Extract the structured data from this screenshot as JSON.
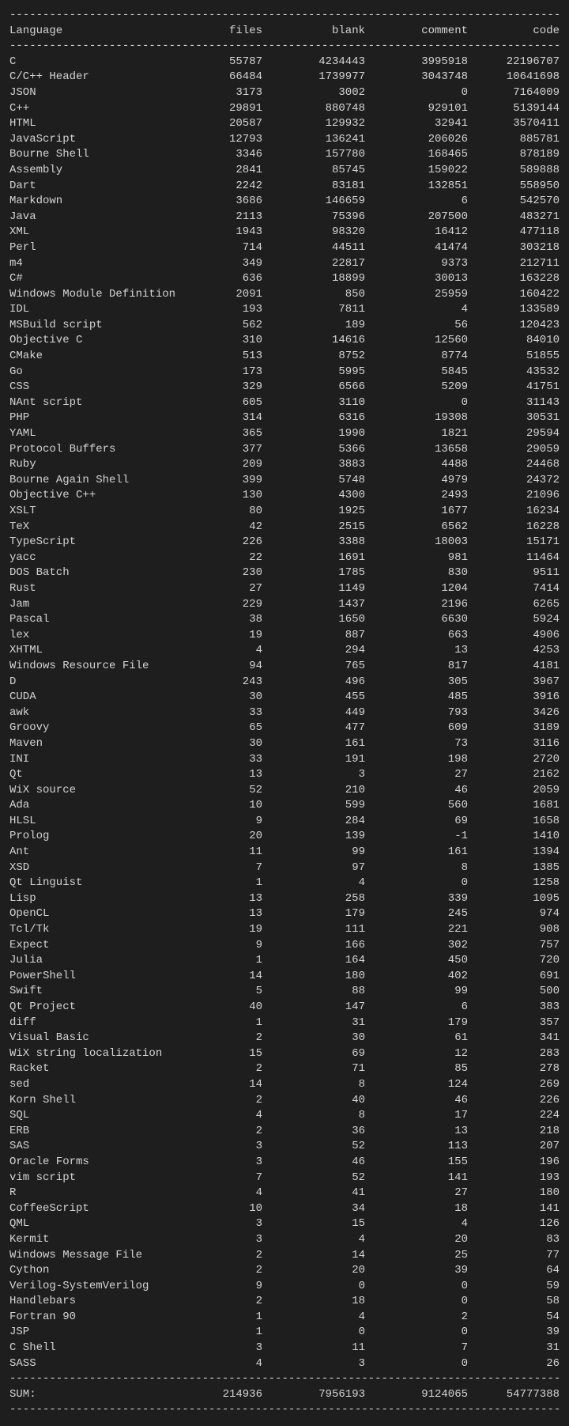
{
  "header": {
    "language": "Language",
    "files": "files",
    "blank": "blank",
    "comment": "comment",
    "code": "code"
  },
  "divider": "-------------------------------------------------------------------------------------",
  "rows": [
    {
      "language": "C",
      "files": "55787",
      "blank": "4234443",
      "comment": "3995918",
      "code": "22196707"
    },
    {
      "language": "C/C++ Header",
      "files": "66484",
      "blank": "1739977",
      "comment": "3043748",
      "code": "10641698"
    },
    {
      "language": "JSON",
      "files": "3173",
      "blank": "3002",
      "comment": "0",
      "code": "7164009"
    },
    {
      "language": "C++",
      "files": "29891",
      "blank": "880748",
      "comment": "929101",
      "code": "5139144"
    },
    {
      "language": "HTML",
      "files": "20587",
      "blank": "129932",
      "comment": "32941",
      "code": "3570411"
    },
    {
      "language": "JavaScript",
      "files": "12793",
      "blank": "136241",
      "comment": "206026",
      "code": "885781"
    },
    {
      "language": "Bourne Shell",
      "files": "3346",
      "blank": "157780",
      "comment": "168465",
      "code": "878189"
    },
    {
      "language": "Assembly",
      "files": "2841",
      "blank": "85745",
      "comment": "159022",
      "code": "589888"
    },
    {
      "language": "Dart",
      "files": "2242",
      "blank": "83181",
      "comment": "132851",
      "code": "558950"
    },
    {
      "language": "Markdown",
      "files": "3686",
      "blank": "146659",
      "comment": "6",
      "code": "542570"
    },
    {
      "language": "Java",
      "files": "2113",
      "blank": "75396",
      "comment": "207500",
      "code": "483271"
    },
    {
      "language": "XML",
      "files": "1943",
      "blank": "98320",
      "comment": "16412",
      "code": "477118"
    },
    {
      "language": "Perl",
      "files": "714",
      "blank": "44511",
      "comment": "41474",
      "code": "303218"
    },
    {
      "language": "m4",
      "files": "349",
      "blank": "22817",
      "comment": "9373",
      "code": "212711"
    },
    {
      "language": "C#",
      "files": "636",
      "blank": "18899",
      "comment": "30013",
      "code": "163228"
    },
    {
      "language": "Windows Module Definition",
      "files": "2091",
      "blank": "850",
      "comment": "25959",
      "code": "160422"
    },
    {
      "language": "IDL",
      "files": "193",
      "blank": "7811",
      "comment": "4",
      "code": "133589"
    },
    {
      "language": "MSBuild script",
      "files": "562",
      "blank": "189",
      "comment": "56",
      "code": "120423"
    },
    {
      "language": "Objective C",
      "files": "310",
      "blank": "14616",
      "comment": "12560",
      "code": "84010"
    },
    {
      "language": "CMake",
      "files": "513",
      "blank": "8752",
      "comment": "8774",
      "code": "51855"
    },
    {
      "language": "Go",
      "files": "173",
      "blank": "5995",
      "comment": "5845",
      "code": "43532"
    },
    {
      "language": "CSS",
      "files": "329",
      "blank": "6566",
      "comment": "5209",
      "code": "41751"
    },
    {
      "language": "NAnt script",
      "files": "605",
      "blank": "3110",
      "comment": "0",
      "code": "31143"
    },
    {
      "language": "PHP",
      "files": "314",
      "blank": "6316",
      "comment": "19308",
      "code": "30531"
    },
    {
      "language": "YAML",
      "files": "365",
      "blank": "1990",
      "comment": "1821",
      "code": "29594"
    },
    {
      "language": "Protocol Buffers",
      "files": "377",
      "blank": "5366",
      "comment": "13658",
      "code": "29059"
    },
    {
      "language": "Ruby",
      "files": "209",
      "blank": "3883",
      "comment": "4488",
      "code": "24468"
    },
    {
      "language": "Bourne Again Shell",
      "files": "399",
      "blank": "5748",
      "comment": "4979",
      "code": "24372"
    },
    {
      "language": "Objective C++",
      "files": "130",
      "blank": "4300",
      "comment": "2493",
      "code": "21096"
    },
    {
      "language": "XSLT",
      "files": "80",
      "blank": "1925",
      "comment": "1677",
      "code": "16234"
    },
    {
      "language": "TeX",
      "files": "42",
      "blank": "2515",
      "comment": "6562",
      "code": "16228"
    },
    {
      "language": "TypeScript",
      "files": "226",
      "blank": "3388",
      "comment": "18003",
      "code": "15171"
    },
    {
      "language": "yacc",
      "files": "22",
      "blank": "1691",
      "comment": "981",
      "code": "11464"
    },
    {
      "language": "DOS Batch",
      "files": "230",
      "blank": "1785",
      "comment": "830",
      "code": "9511"
    },
    {
      "language": "Rust",
      "files": "27",
      "blank": "1149",
      "comment": "1204",
      "code": "7414"
    },
    {
      "language": "Jam",
      "files": "229",
      "blank": "1437",
      "comment": "2196",
      "code": "6265"
    },
    {
      "language": "Pascal",
      "files": "38",
      "blank": "1650",
      "comment": "6630",
      "code": "5924"
    },
    {
      "language": "lex",
      "files": "19",
      "blank": "887",
      "comment": "663",
      "code": "4906"
    },
    {
      "language": "XHTML",
      "files": "4",
      "blank": "294",
      "comment": "13",
      "code": "4253"
    },
    {
      "language": "Windows Resource File",
      "files": "94",
      "blank": "765",
      "comment": "817",
      "code": "4181"
    },
    {
      "language": "D",
      "files": "243",
      "blank": "496",
      "comment": "305",
      "code": "3967"
    },
    {
      "language": "CUDA",
      "files": "30",
      "blank": "455",
      "comment": "485",
      "code": "3916"
    },
    {
      "language": "awk",
      "files": "33",
      "blank": "449",
      "comment": "793",
      "code": "3426"
    },
    {
      "language": "Groovy",
      "files": "65",
      "blank": "477",
      "comment": "609",
      "code": "3189"
    },
    {
      "language": "Maven",
      "files": "30",
      "blank": "161",
      "comment": "73",
      "code": "3116"
    },
    {
      "language": "INI",
      "files": "33",
      "blank": "191",
      "comment": "198",
      "code": "2720"
    },
    {
      "language": "Qt",
      "files": "13",
      "blank": "3",
      "comment": "27",
      "code": "2162"
    },
    {
      "language": "WiX source",
      "files": "52",
      "blank": "210",
      "comment": "46",
      "code": "2059"
    },
    {
      "language": "Ada",
      "files": "10",
      "blank": "599",
      "comment": "560",
      "code": "1681"
    },
    {
      "language": "HLSL",
      "files": "9",
      "blank": "284",
      "comment": "69",
      "code": "1658"
    },
    {
      "language": "Prolog",
      "files": "20",
      "blank": "139",
      "comment": "-1",
      "code": "1410"
    },
    {
      "language": "Ant",
      "files": "11",
      "blank": "99",
      "comment": "161",
      "code": "1394"
    },
    {
      "language": "XSD",
      "files": "7",
      "blank": "97",
      "comment": "8",
      "code": "1385"
    },
    {
      "language": "Qt Linguist",
      "files": "1",
      "blank": "4",
      "comment": "0",
      "code": "1258"
    },
    {
      "language": "Lisp",
      "files": "13",
      "blank": "258",
      "comment": "339",
      "code": "1095"
    },
    {
      "language": "OpenCL",
      "files": "13",
      "blank": "179",
      "comment": "245",
      "code": "974"
    },
    {
      "language": "Tcl/Tk",
      "files": "19",
      "blank": "111",
      "comment": "221",
      "code": "908"
    },
    {
      "language": "Expect",
      "files": "9",
      "blank": "166",
      "comment": "302",
      "code": "757"
    },
    {
      "language": "Julia",
      "files": "1",
      "blank": "164",
      "comment": "450",
      "code": "720"
    },
    {
      "language": "PowerShell",
      "files": "14",
      "blank": "180",
      "comment": "402",
      "code": "691"
    },
    {
      "language": "Swift",
      "files": "5",
      "blank": "88",
      "comment": "99",
      "code": "500"
    },
    {
      "language": "Qt Project",
      "files": "40",
      "blank": "147",
      "comment": "6",
      "code": "383"
    },
    {
      "language": "diff",
      "files": "1",
      "blank": "31",
      "comment": "179",
      "code": "357"
    },
    {
      "language": "Visual Basic",
      "files": "2",
      "blank": "30",
      "comment": "61",
      "code": "341"
    },
    {
      "language": "WiX string localization",
      "files": "15",
      "blank": "69",
      "comment": "12",
      "code": "283"
    },
    {
      "language": "Racket",
      "files": "2",
      "blank": "71",
      "comment": "85",
      "code": "278"
    },
    {
      "language": "sed",
      "files": "14",
      "blank": "8",
      "comment": "124",
      "code": "269"
    },
    {
      "language": "Korn Shell",
      "files": "2",
      "blank": "40",
      "comment": "46",
      "code": "226"
    },
    {
      "language": "SQL",
      "files": "4",
      "blank": "8",
      "comment": "17",
      "code": "224"
    },
    {
      "language": "ERB",
      "files": "2",
      "blank": "36",
      "comment": "13",
      "code": "218"
    },
    {
      "language": "SAS",
      "files": "3",
      "blank": "52",
      "comment": "113",
      "code": "207"
    },
    {
      "language": "Oracle Forms",
      "files": "3",
      "blank": "46",
      "comment": "155",
      "code": "196"
    },
    {
      "language": "vim script",
      "files": "7",
      "blank": "52",
      "comment": "141",
      "code": "193"
    },
    {
      "language": "R",
      "files": "4",
      "blank": "41",
      "comment": "27",
      "code": "180"
    },
    {
      "language": "CoffeeScript",
      "files": "10",
      "blank": "34",
      "comment": "18",
      "code": "141"
    },
    {
      "language": "QML",
      "files": "3",
      "blank": "15",
      "comment": "4",
      "code": "126"
    },
    {
      "language": "Kermit",
      "files": "3",
      "blank": "4",
      "comment": "20",
      "code": "83"
    },
    {
      "language": "Windows Message File",
      "files": "2",
      "blank": "14",
      "comment": "25",
      "code": "77"
    },
    {
      "language": "Cython",
      "files": "2",
      "blank": "20",
      "comment": "39",
      "code": "64"
    },
    {
      "language": "Verilog-SystemVerilog",
      "files": "9",
      "blank": "0",
      "comment": "0",
      "code": "59"
    },
    {
      "language": "Handlebars",
      "files": "2",
      "blank": "18",
      "comment": "0",
      "code": "58"
    },
    {
      "language": "Fortran 90",
      "files": "1",
      "blank": "4",
      "comment": "2",
      "code": "54"
    },
    {
      "language": "JSP",
      "files": "1",
      "blank": "0",
      "comment": "0",
      "code": "39"
    },
    {
      "language": "C Shell",
      "files": "3",
      "blank": "11",
      "comment": "7",
      "code": "31"
    },
    {
      "language": "SASS",
      "files": "4",
      "blank": "3",
      "comment": "0",
      "code": "26"
    }
  ],
  "sum": {
    "label": "SUM:",
    "files": "214936",
    "blank": "7956193",
    "comment": "9124065",
    "code": "54777388"
  }
}
